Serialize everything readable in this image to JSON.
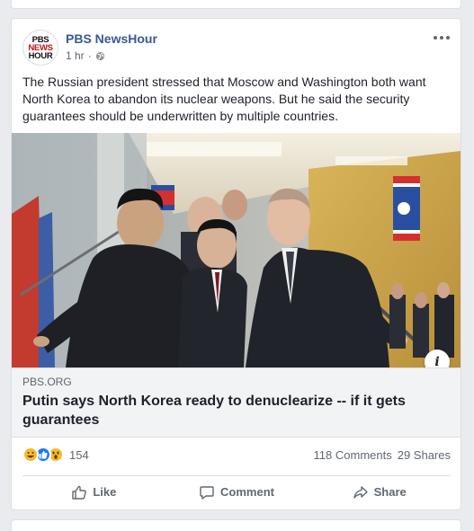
{
  "post": {
    "page_name": "PBS NewsHour",
    "avatar_lines": [
      "PBS",
      "NEWS",
      "HOUR"
    ],
    "timestamp": "1 hr",
    "audience_icon": "globe-icon",
    "text": "The Russian president stressed that Moscow and Washington both want North Korea to abandon its nuclear weapons. But he said the security guarantees should be underwritten by multiple countries."
  },
  "link": {
    "domain": "PBS.ORG",
    "headline": "Putin says North Korea ready to denuclearize -- if it gets guarantees",
    "info_label": "i",
    "photo_subject": "leaders-on-staircase-photo"
  },
  "engagement": {
    "reaction_icons": [
      "haha-icon",
      "like-icon",
      "wow-icon"
    ],
    "reaction_count": "154",
    "comments": "118 Comments",
    "shares": "29 Shares"
  },
  "actions": {
    "like": "Like",
    "comment": "Comment",
    "share": "Share"
  },
  "colors": {
    "link_blue": "#385898",
    "like_blue": "#2078f4",
    "haha_yellow": "#f7b928",
    "muted_text": "#606770",
    "background": "#e9ebee"
  }
}
